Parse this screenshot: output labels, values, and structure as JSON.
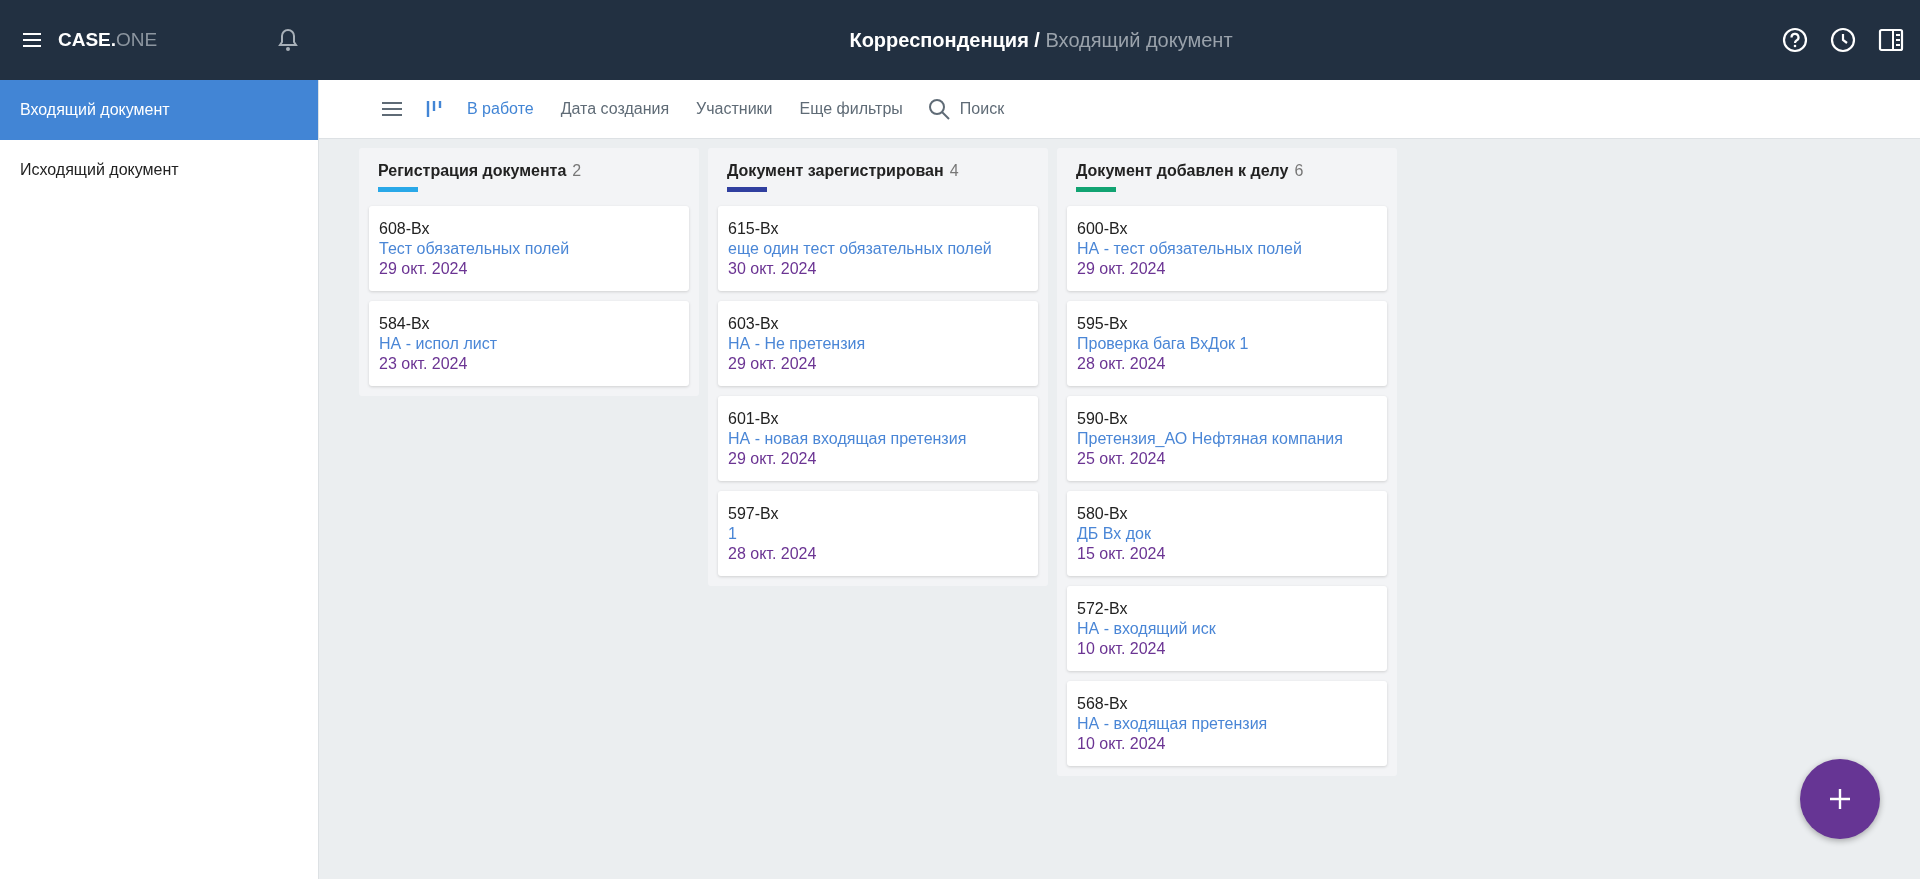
{
  "header": {
    "logo": {
      "main": "CASE.",
      "suffix": "ONE"
    },
    "breadcrumb": {
      "parent": "Корреспонденция /",
      "current": "Входящий документ"
    }
  },
  "sidebar": {
    "items": [
      {
        "label": "Входящий документ",
        "selected": true
      },
      {
        "label": "Исходящий документ",
        "selected": false
      }
    ]
  },
  "toolbar": {
    "views": [
      {
        "kind": "list",
        "selected": false
      },
      {
        "kind": "board",
        "selected": true
      }
    ],
    "filters": [
      {
        "label": "В работе",
        "selected": true
      },
      {
        "label": "Дата создания",
        "selected": false
      },
      {
        "label": "Участники",
        "selected": false
      },
      {
        "label": "Еще фильтры",
        "selected": false
      }
    ],
    "search": {
      "placeholder": "Поиск"
    }
  },
  "columns": [
    {
      "title": "Регистрация документа",
      "count": "2",
      "color": "#29a8e8",
      "cards": [
        {
          "number": "608-Вх",
          "title": "Тест обязательных полей",
          "date": "29 окт. 2024"
        },
        {
          "number": "584-Вх",
          "title": "НА - испол лист",
          "date": "23 окт. 2024"
        }
      ]
    },
    {
      "title": "Документ зарегистрирован",
      "count": "4",
      "color": "#303f9f",
      "cards": [
        {
          "number": "615-Вх",
          "title": "еще один тест обязательных полей",
          "date": "30 окт. 2024"
        },
        {
          "number": "603-Вх",
          "title": "НА - Не претензия",
          "date": "29 окт. 2024"
        },
        {
          "number": "601-Вх",
          "title": "НА - новая входящая претензия",
          "date": "29 окт. 2024"
        },
        {
          "number": "597-Вх",
          "title": "1",
          "date": "28 окт. 2024"
        }
      ]
    },
    {
      "title": "Документ добавлен к делу",
      "count": "6",
      "color": "#11a372",
      "cards": [
        {
          "number": "600-Вх",
          "title": "НА - тест обязательных полей",
          "date": "29 окт. 2024"
        },
        {
          "number": "595-Вх",
          "title": "Проверка бага ВхДок 1",
          "date": "28 окт. 2024"
        },
        {
          "number": "590-Вх",
          "title": "Претензия_АО Нефтяная компания",
          "date": "25 окт. 2024"
        },
        {
          "number": "580-Вх",
          "title": "ДБ Вх док",
          "date": "15 окт. 2024"
        },
        {
          "number": "572-Вх",
          "title": "НА - входящий иск",
          "date": "10 окт. 2024"
        },
        {
          "number": "568-Вх",
          "title": "НА - входящая претензия",
          "date": "10 окт. 2024"
        }
      ]
    }
  ]
}
